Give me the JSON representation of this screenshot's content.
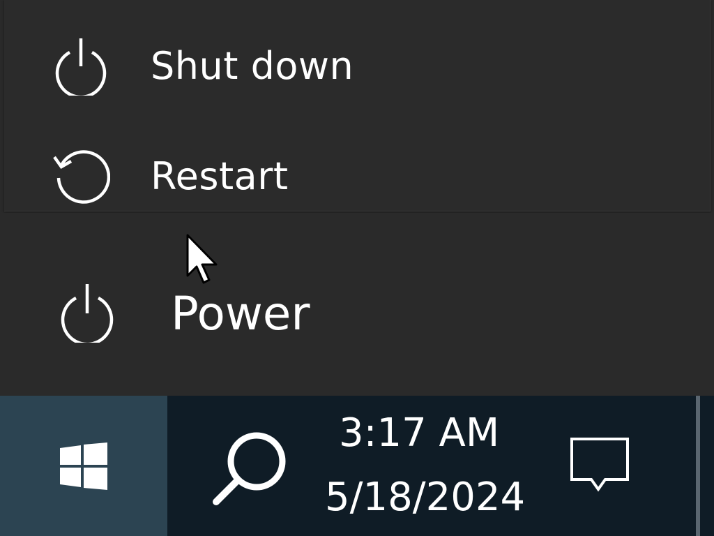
{
  "power_menu": {
    "items": [
      {
        "label": "Shut down",
        "icon": "power-icon"
      },
      {
        "label": "Restart",
        "icon": "restart-icon"
      }
    ]
  },
  "start_menu": {
    "power_label": "Power",
    "power_icon": "power-icon"
  },
  "taskbar": {
    "start_icon": "windows-logo-icon",
    "search_icon": "search-icon",
    "time": "3:17 AM",
    "date": "5/18/2024",
    "action_center_icon": "action-center-icon"
  },
  "colors": {
    "flyout_bg": "#2b2b2b",
    "start_bg": "#2a2a2a",
    "taskbar_bg": "#0f1c26",
    "start_button_bg": "#2c4452",
    "text": "#ffffff"
  }
}
